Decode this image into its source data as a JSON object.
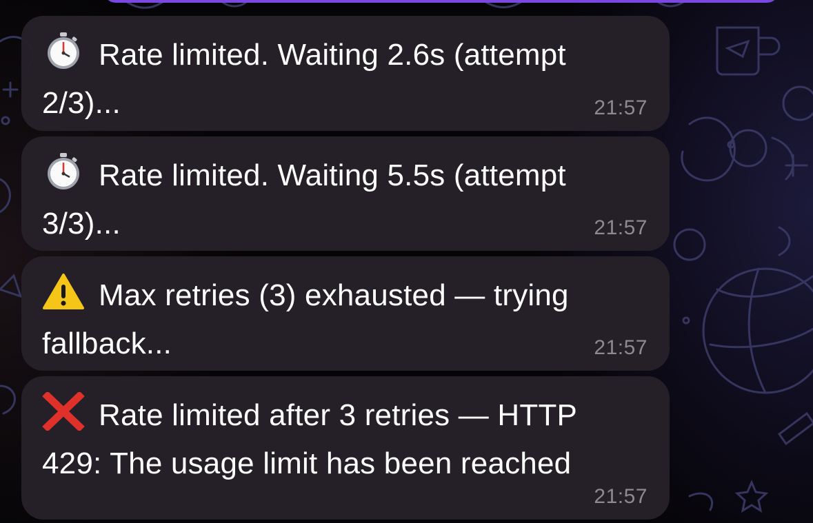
{
  "messages": [
    {
      "icon": "stopwatch-icon",
      "text": "Rate limited. Waiting 2.6s (attempt\n2/3)...",
      "time": "21:57"
    },
    {
      "icon": "stopwatch-icon",
      "text": "Rate limited. Waiting 5.5s (attempt\n3/3)...",
      "time": "21:57"
    },
    {
      "icon": "warning-icon",
      "text": "Max retries (3) exhausted — trying\nfallback...",
      "time": "21:57"
    },
    {
      "icon": "cross-mark-icon",
      "text": "Rate limited after 3 retries — HTTP\n429: The usage limit has been reached",
      "time": "21:57"
    }
  ],
  "colors": {
    "bubble": "#262128",
    "text": "#ffffff",
    "timestamp": "#8c8a90",
    "accent": "#7a48e0",
    "warning": "#f5c518",
    "error": "#e0302a"
  }
}
